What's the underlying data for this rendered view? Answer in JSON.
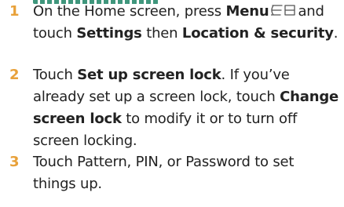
{
  "steps": [
    {
      "number": "1",
      "parts": {
        "a": "On the Home screen, press",
        "b": "Menu",
        "c": "and touch",
        "d": "Settings",
        "e": "then",
        "f": "Location & security",
        "g": "."
      },
      "icon": "menu-icon"
    },
    {
      "number": "2",
      "parts": {
        "a": "Touch",
        "b": "Set up screen lock",
        "c": ". If you’ve already set up a screen lock, touch",
        "d": "Change screen lock",
        "e": "to modify it or to turn off screen locking."
      }
    },
    {
      "number": "3",
      "parts": {
        "a": "Touch Pattern, PIN, or Password to set things up."
      }
    }
  ],
  "colors": {
    "step_number": "#e8a13a",
    "text": "#222222"
  }
}
